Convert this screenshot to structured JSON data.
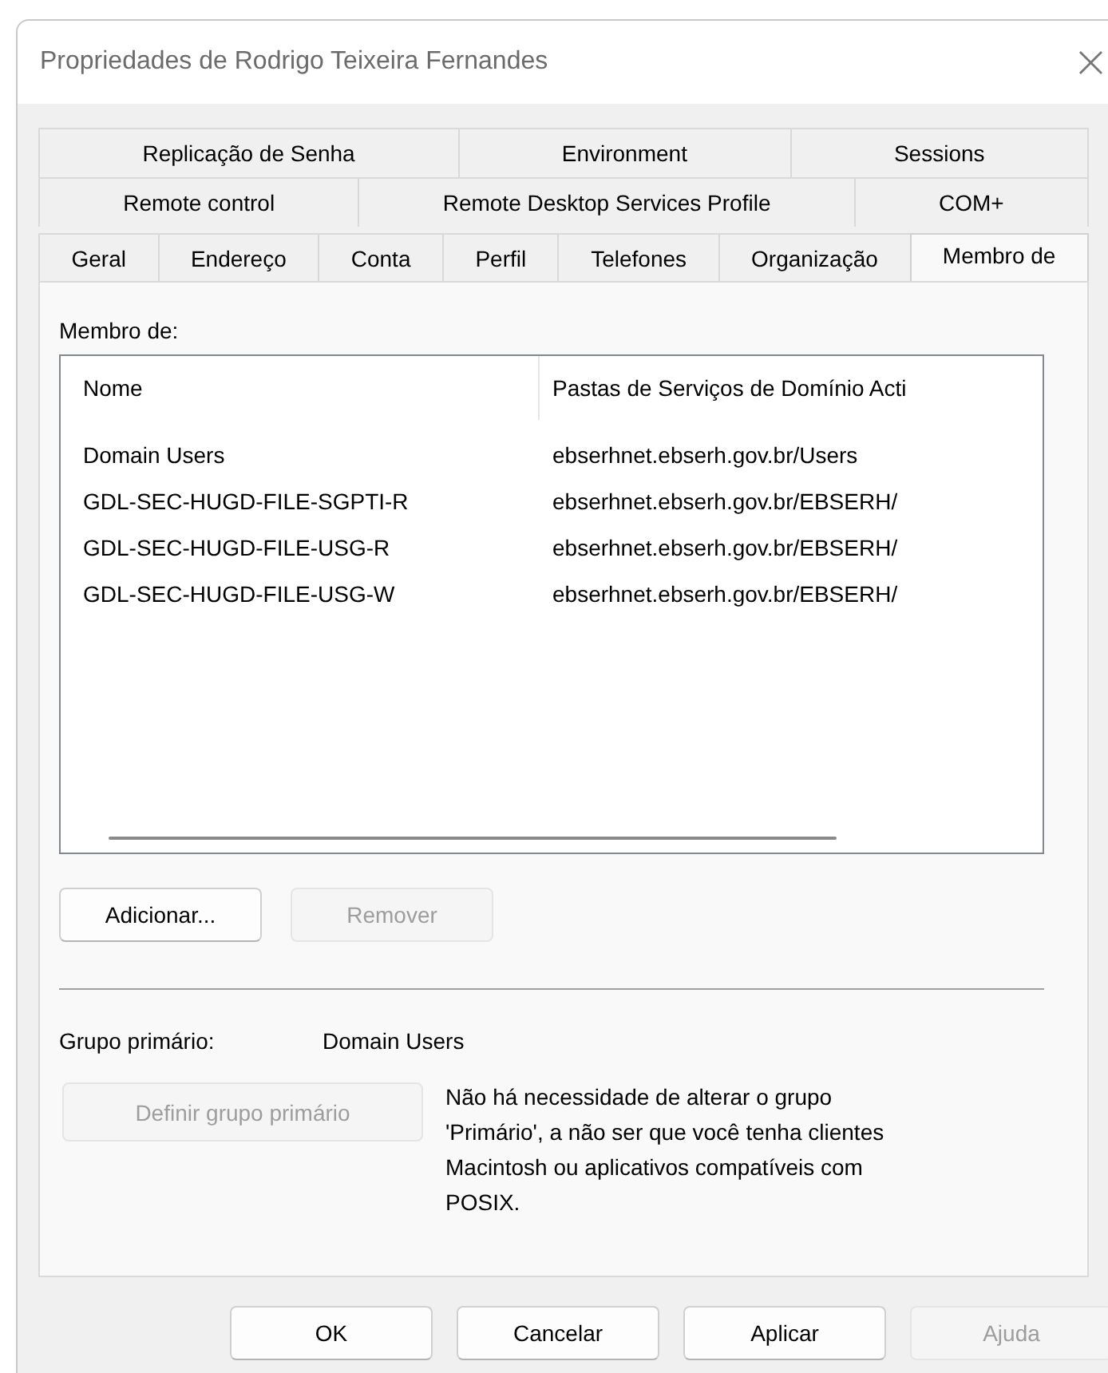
{
  "window": {
    "title": "Propriedades de Rodrigo Teixeira Fernandes",
    "close": "×"
  },
  "tab_rows": [
    [
      {
        "label": "Replicação de Senha",
        "selected": false
      },
      {
        "label": "Environment",
        "selected": false
      },
      {
        "label": "Sessions",
        "selected": false
      }
    ],
    [
      {
        "label": "Remote control",
        "selected": false
      },
      {
        "label": "Remote Desktop Services Profile",
        "selected": false
      },
      {
        "label": "COM+",
        "selected": false
      }
    ],
    [
      {
        "label": "Geral",
        "selected": false
      },
      {
        "label": "Endereço",
        "selected": false
      },
      {
        "label": "Conta",
        "selected": false
      },
      {
        "label": "Perfil",
        "selected": false
      },
      {
        "label": "Telefones",
        "selected": false
      },
      {
        "label": "Organização",
        "selected": false
      },
      {
        "label": "Membro de",
        "selected": true
      }
    ]
  ],
  "member_of": {
    "label": "Membro de:",
    "columns": [
      "Nome",
      "Pastas de Serviços de Domínio Acti"
    ],
    "rows": [
      {
        "cells": [
          "Domain Users",
          "ebserhnet.ebserh.gov.br/Users"
        ]
      },
      {
        "cells": [
          "GDL-SEC-HUGD-FILE-SGPTI-R",
          "ebserhnet.ebserh.gov.br/EBSERH/"
        ]
      },
      {
        "cells": [
          "GDL-SEC-HUGD-FILE-USG-R",
          "ebserhnet.ebserh.gov.br/EBSERH/"
        ]
      },
      {
        "cells": [
          "GDL-SEC-HUGD-FILE-USG-W",
          "ebserhnet.ebserh.gov.br/EBSERH/"
        ]
      }
    ],
    "buttons": [
      {
        "label": "Adicionar...",
        "disabled": false
      },
      {
        "label": "Remover",
        "disabled": true
      }
    ]
  },
  "primary_group": {
    "label": "Grupo primário:",
    "value": "Domain Users",
    "button": {
      "label": "Definir grupo primário",
      "disabled": true
    },
    "note": "Não há necessidade de alterar o grupo 'Primário', a não ser que você tenha clientes Macintosh ou aplicativos compatíveis com POSIX."
  },
  "footer_buttons": [
    {
      "label": "OK",
      "disabled": false
    },
    {
      "label": "Cancelar",
      "disabled": false
    },
    {
      "label": "Aplicar",
      "disabled": false
    },
    {
      "label": "Ajuda",
      "disabled": true
    }
  ]
}
